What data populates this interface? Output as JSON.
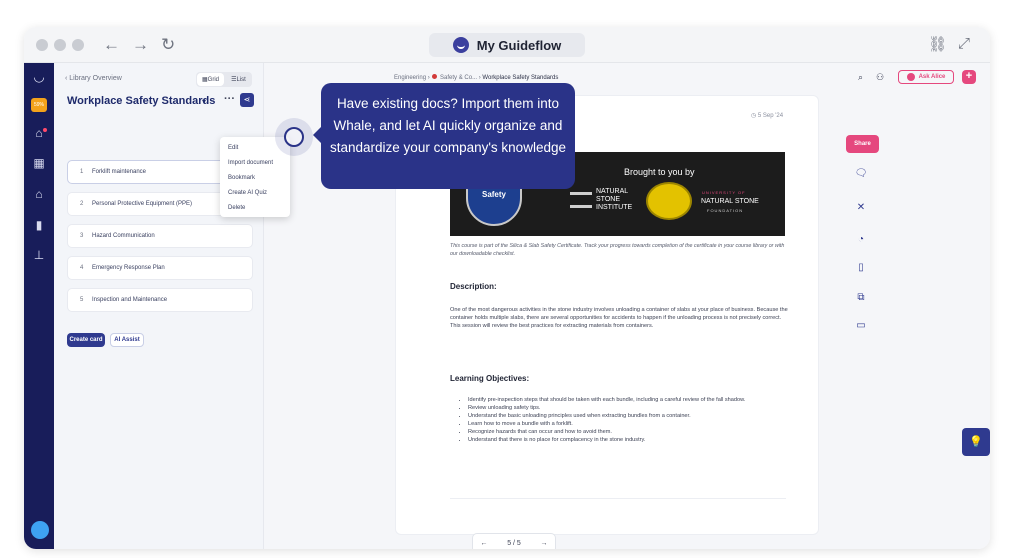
{
  "browser": {
    "title": "My Guideflow",
    "back_glyph": "←",
    "forward_glyph": "→",
    "reload_glyph": "↻",
    "link_glyph": "⛓",
    "expand_glyph": "⤢"
  },
  "rail": {
    "badge": "59%"
  },
  "sidebar": {
    "back_label": "Library Overview",
    "view_grid": "Grid",
    "view_list": "List",
    "title": "Workplace Safety Standards",
    "cards": [
      {
        "num": "1",
        "label": "Forklift maintenance"
      },
      {
        "num": "2",
        "label": "Personal Protective Equipment (PPE)"
      },
      {
        "num": "3",
        "label": "Hazard Communication"
      },
      {
        "num": "4",
        "label": "Emergency Response Plan"
      },
      {
        "num": "5",
        "label": "Inspection and Maintenance"
      }
    ],
    "create_card": "Create card",
    "ai_assist": "AI Assist"
  },
  "menu": {
    "items": [
      "Edit",
      "Import document",
      "Bookmark",
      "Create AI Quiz",
      "Delete"
    ]
  },
  "breadcrumb": {
    "root": "Engineering",
    "mid": "Safety & Co...",
    "current": "Workplace Safety Standards"
  },
  "header": {
    "ask": "Ask Alice"
  },
  "doc": {
    "date": "5 Sep '24",
    "banner": {
      "brought": "Brought to you by",
      "silica": "Silica & Slab Safety",
      "nsi": "NATURAL STONE INSTITUTE",
      "nsf_top": "UNIVERSITY OF",
      "nsf": "NATURAL STONE",
      "nsf_sub": "FOUNDATION"
    },
    "intro": "This course is part of the Silica & Slab Safety Certificate. Track your progress towards completion of the certificate in your course library or with our downloadable checklist.",
    "description_heading": "Description:",
    "description": "One of the most dangerous activities in the stone industry involves unloading a container of slabs at your place of business.  Because the container holds multiple slabs, there are several opportunities for accidents to happen if the unloading process is not precisely correct.  This session will review the best practices for extracting materials from containers.",
    "objectives_heading": "Learning Objectives:",
    "objectives": [
      "Identify pre-inspection steps that should be taken with each bundle, including a careful review of the fall shadow.",
      "Review unloading safety tips.",
      "Understand the basic unloading principles used when extracting bundles from a container.",
      "Learn how to move a bundle with a forklift.",
      "Recognize hazards that can occur and how to avoid them.",
      "Understand that there is no place for complacency in the stone industry."
    ],
    "pager": "5 / 5"
  },
  "right_bar": {
    "share": "Share"
  },
  "tooltip": {
    "text": "Have existing docs? Import them into Whale, and let AI quickly organize and standardize your company's knowledge"
  },
  "colors": {
    "brand_navy": "#2a3388",
    "rail": "#181d5a",
    "accent_pink": "#e5487e"
  }
}
